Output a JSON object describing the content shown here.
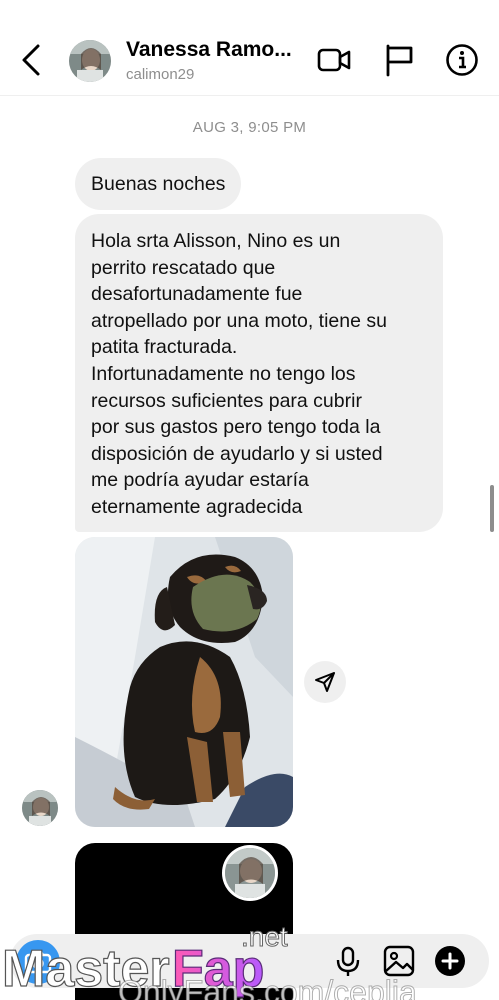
{
  "header": {
    "name": "Vanessa Ramo...",
    "username": "calimon29",
    "icons": [
      "chevron-left-icon",
      "video-camera-icon",
      "flag-icon",
      "info-icon"
    ]
  },
  "conversation": {
    "timestamp": "AUG 3, 9:05 PM",
    "messages": [
      {
        "text": "Buenas noches"
      },
      {
        "lines": [
          "Hola srta Alisson, Nino es un",
          "perrito rescatado que",
          "desafortunadamente fue",
          "atropellado por una moto, tiene su",
          "patita fracturada.",
          "Infortunadamente no tengo los",
          "recursos suficientes para  cubrir",
          "por sus gastos pero tengo toda la",
          "disposición de ayudarlo y si usted",
          "me podría ayudar estaría",
          "eternamente agradecida"
        ]
      }
    ]
  },
  "composer": {
    "icons": [
      "camera-icon",
      "microphone-icon",
      "gallery-icon",
      "plus-icon"
    ],
    "accent_color": "#3797f0"
  },
  "watermark": {
    "logo_text": "MasterFap",
    "logo_suffix": ".net",
    "url_text": "OnlyFans.com/ceplia"
  }
}
